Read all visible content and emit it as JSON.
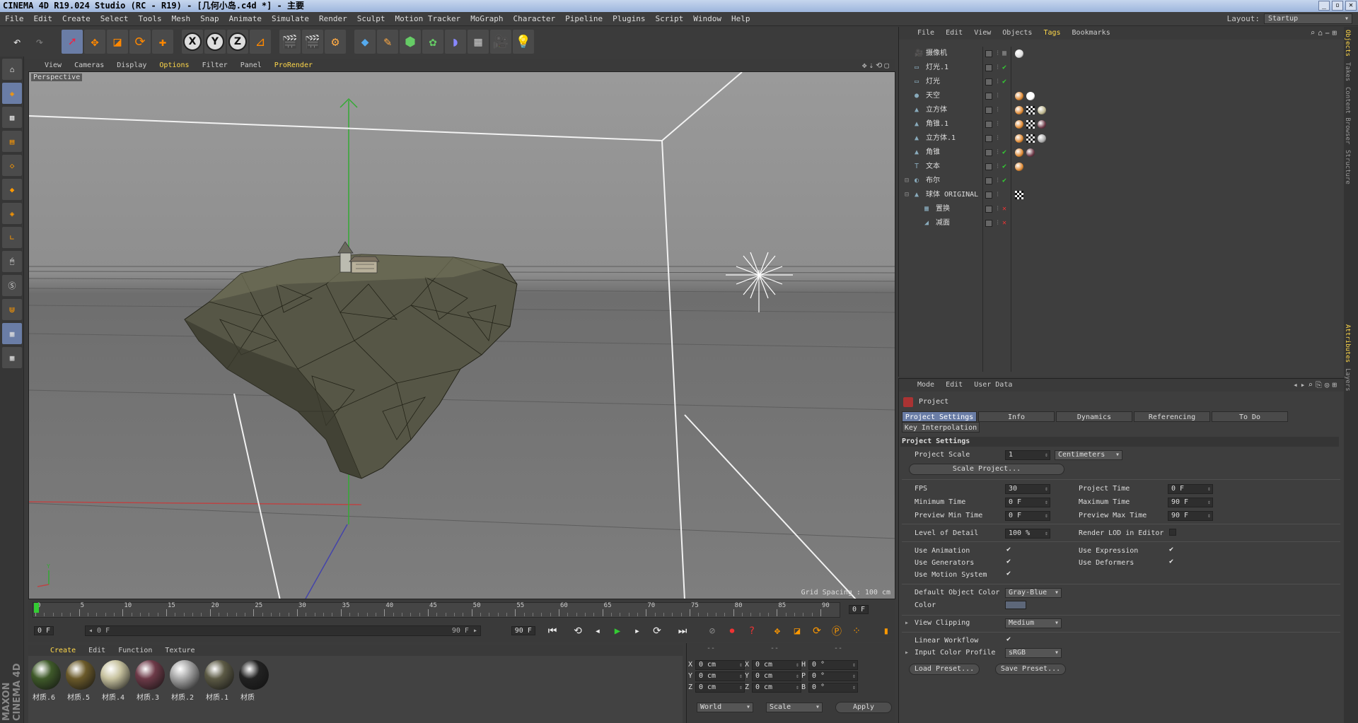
{
  "title": "CINEMA 4D R19.024 Studio (RC - R19) - [几何小岛.c4d *] - 主要",
  "window_buttons": [
    "_",
    "▫",
    "✕"
  ],
  "menu": [
    "File",
    "Edit",
    "Create",
    "Select",
    "Tools",
    "Mesh",
    "Snap",
    "Animate",
    "Simulate",
    "Render",
    "Sculpt",
    "Motion Tracker",
    "MoGraph",
    "Character",
    "Pipeline",
    "Plugins",
    "Script",
    "Window",
    "Help"
  ],
  "layout_label": "Layout:",
  "layout_value": "Startup",
  "viewport": {
    "menu": [
      "View",
      "Cameras",
      "Display",
      "Options",
      "Filter",
      "Panel",
      "ProRender"
    ],
    "label": "Perspective",
    "grid_spacing": "Grid Spacing : 100 cm",
    "nav_icons": "✥⇣⟲▢"
  },
  "timeline": {
    "ticks": [
      "0",
      "5",
      "10",
      "15",
      "20",
      "25",
      "30",
      "35",
      "40",
      "45",
      "50",
      "55",
      "60",
      "65",
      "70",
      "75",
      "80",
      "85",
      "90"
    ],
    "current_frame": "0 F",
    "start": "0 F",
    "range_left": "◂ 0 F",
    "range_right": "90 F ▸",
    "end": "90 F"
  },
  "materials": {
    "menu": [
      "Create",
      "Edit",
      "Function",
      "Texture"
    ],
    "items": [
      {
        "label": "材质.6",
        "color": "#3f5a2a"
      },
      {
        "label": "材质.5",
        "color": "#6b5a2a"
      },
      {
        "label": "材质.4",
        "color": "#c8c3a0"
      },
      {
        "label": "材质.3",
        "color": "#6d3a48"
      },
      {
        "label": "材质.2",
        "color": "#a8a8a8"
      },
      {
        "label": "材质.1",
        "color": "#5c5a45"
      },
      {
        "label": "材质",
        "color": "#222222"
      }
    ]
  },
  "coords": {
    "header": [
      "--",
      "--",
      "--"
    ],
    "rows": [
      {
        "a": "X",
        "av": "0 cm",
        "b": "X",
        "bv": "0 cm",
        "c": "H",
        "cv": "0 °"
      },
      {
        "a": "Y",
        "av": "0 cm",
        "b": "Y",
        "bv": "0 cm",
        "c": "P",
        "cv": "0 °"
      },
      {
        "a": "Z",
        "av": "0 cm",
        "b": "Z",
        "bv": "0 cm",
        "c": "B",
        "cv": "0 °"
      }
    ],
    "world": "World",
    "scale": "Scale",
    "apply": "Apply"
  },
  "object_manager": {
    "menu": [
      "File",
      "Edit",
      "View",
      "Objects",
      "Tags",
      "Bookmarks"
    ],
    "objects": [
      {
        "name": "摄像机",
        "icon": "🎥",
        "indent": 0,
        "status": "on"
      },
      {
        "name": "灯光.1",
        "icon": "▭",
        "indent": 0,
        "status": "check"
      },
      {
        "name": "灯光",
        "icon": "▭",
        "indent": 0,
        "status": "check"
      },
      {
        "name": "天空",
        "icon": "●",
        "indent": 0,
        "status": "on"
      },
      {
        "name": "立方体",
        "icon": "▲",
        "indent": 0,
        "status": "on"
      },
      {
        "name": "角锥.1",
        "icon": "▲",
        "indent": 0,
        "status": "on"
      },
      {
        "name": "立方体.1",
        "icon": "▲",
        "indent": 0,
        "status": "on"
      },
      {
        "name": "角锥",
        "icon": "▲",
        "indent": 0,
        "status": "check"
      },
      {
        "name": "文本",
        "icon": "T",
        "indent": 0,
        "status": "check"
      },
      {
        "name": "布尔",
        "icon": "◐",
        "indent": 0,
        "status": "check"
      },
      {
        "name": "球体 ORIGINAL",
        "icon": "▲",
        "indent": 0,
        "status": "on"
      },
      {
        "name": "置换",
        "icon": "▦",
        "indent": 1,
        "status": "x"
      },
      {
        "name": "减面",
        "icon": "◢",
        "indent": 1,
        "status": "x"
      }
    ],
    "side_tabs": [
      "Objects",
      "Takes",
      "Content Browser",
      "Structure"
    ]
  },
  "attributes": {
    "menu": [
      "Mode",
      "Edit",
      "User Data"
    ],
    "header": "Project",
    "tabs": [
      "Project Settings",
      "Info",
      "Dynamics",
      "Referencing",
      "To Do"
    ],
    "tab2": "Key Interpolation",
    "section": "Project Settings",
    "project_scale_label": "Project Scale",
    "project_scale_value": "1",
    "project_scale_unit": "Centimeters",
    "scale_project_btn": "Scale Project...",
    "fps_label": "FPS",
    "fps_value": "30",
    "project_time_label": "Project Time",
    "project_time_value": "0 F",
    "min_time_label": "Minimum Time",
    "min_time_value": "0 F",
    "max_time_label": "Maximum Time",
    "max_time_value": "90 F",
    "prev_min_label": "Preview Min Time",
    "prev_min_value": "0 F",
    "prev_max_label": "Preview Max Time",
    "prev_max_value": "90 F",
    "lod_label": "Level of Detail",
    "lod_value": "100 %",
    "render_lod_label": "Render LOD in Editor",
    "use_animation_label": "Use Animation",
    "use_expression_label": "Use Expression",
    "use_generators_label": "Use Generators",
    "use_deformers_label": "Use Deformers",
    "use_motion_label": "Use Motion System",
    "default_color_label": "Default Object Color",
    "default_color_value": "Gray-Blue",
    "color_label": "Color",
    "view_clipping_label": "View Clipping",
    "view_clipping_value": "Medium",
    "linear_workflow_label": "Linear Workflow",
    "input_profile_label": "Input Color Profile",
    "input_profile_value": "sRGB",
    "load_preset": "Load Preset...",
    "save_preset": "Save Preset...",
    "side_tabs": [
      "Attributes",
      "Layers"
    ]
  },
  "brand": "MAXON CINEMA 4D"
}
